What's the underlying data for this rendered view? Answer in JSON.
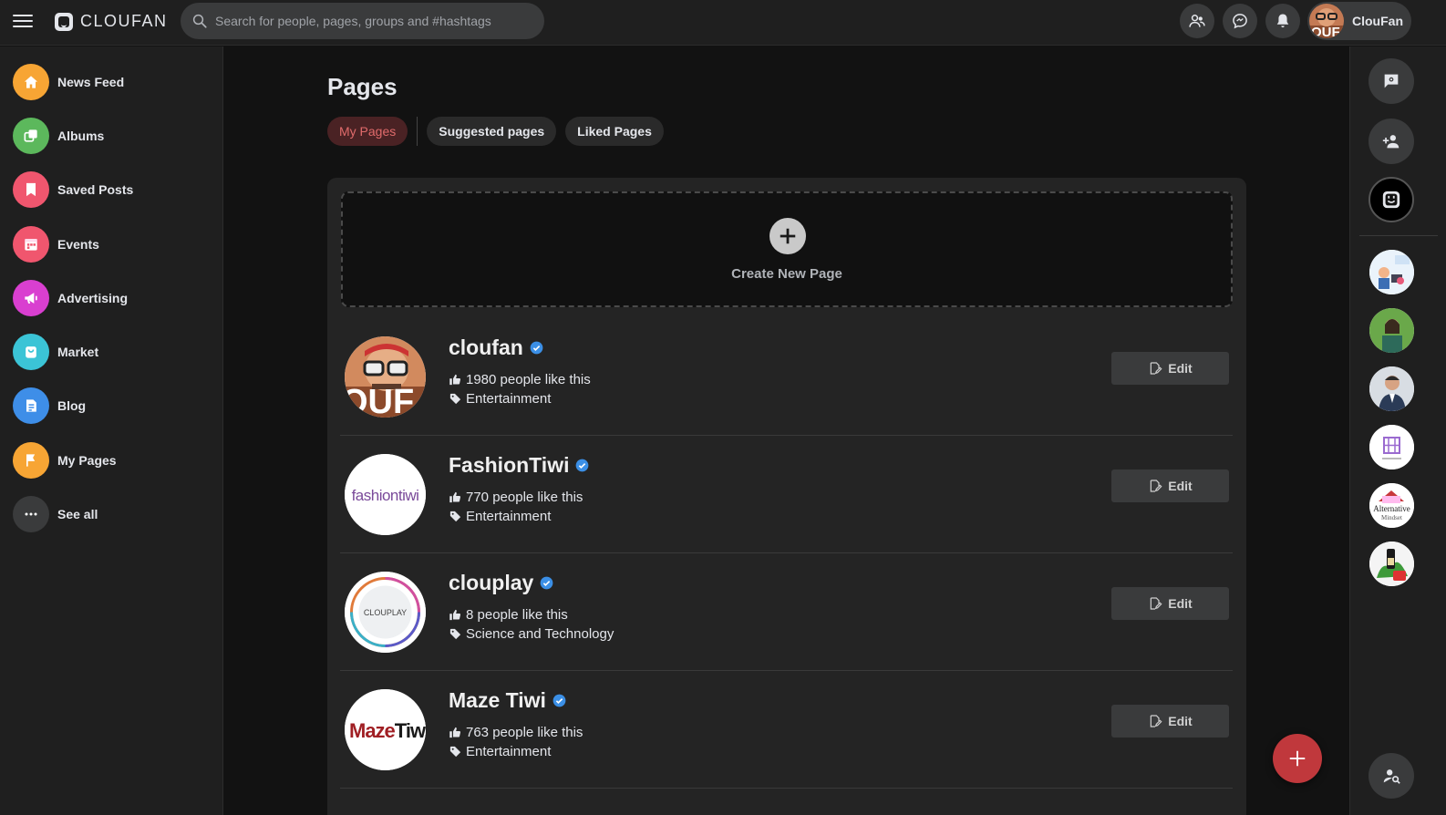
{
  "app": {
    "logo_text": "CLOUFAN"
  },
  "search": {
    "placeholder": "Search for people, pages, groups and #hashtags"
  },
  "header": {
    "user_name": "ClouFan"
  },
  "sidebar": {
    "items": [
      {
        "label": "News Feed",
        "icon": "home-icon",
        "color": "#f7a534"
      },
      {
        "label": "Albums",
        "icon": "albums-icon",
        "color": "#5cb85c"
      },
      {
        "label": "Saved Posts",
        "icon": "bookmark-icon",
        "color": "#f0566e"
      },
      {
        "label": "Events",
        "icon": "calendar-icon",
        "color": "#f0566e"
      },
      {
        "label": "Advertising",
        "icon": "megaphone-icon",
        "color": "#d93fd0"
      },
      {
        "label": "Market",
        "icon": "shopping-bag-icon",
        "color": "#3bc4d6"
      },
      {
        "label": "Blog",
        "icon": "blog-icon",
        "color": "#3e8ee8"
      },
      {
        "label": "My Pages",
        "icon": "flag-icon",
        "color": "#f7a534"
      },
      {
        "label": "See all",
        "icon": "more-icon",
        "color": "#3a3b3c"
      }
    ]
  },
  "main": {
    "title": "Pages",
    "tabs": [
      {
        "label": "My Pages",
        "active": true
      },
      {
        "label": "Suggested pages",
        "active": false
      },
      {
        "label": "Liked Pages",
        "active": false
      }
    ],
    "create_label": "Create New Page",
    "pages": [
      {
        "name": "cloufan",
        "likes": "1980 people like this",
        "category": "Entertainment",
        "edit_label": "Edit"
      },
      {
        "name": "FashionTiwi",
        "likes": "770 people like this",
        "category": "Entertainment",
        "edit_label": "Edit",
        "logo_text": "fashiontiwi"
      },
      {
        "name": "clouplay",
        "likes": "8 people like this",
        "category": "Science and Technology",
        "edit_label": "Edit",
        "logo_text": "CLOUPLAY"
      },
      {
        "name": "Maze Tiwi",
        "likes": "763 people like this",
        "category": "Entertainment",
        "edit_label": "Edit",
        "logo_text_a": "Maze",
        "logo_text_b": "Tiwi"
      }
    ]
  },
  "rightbar": {
    "avatar_texts": [
      "Alternative",
      "Mindset"
    ]
  },
  "colors": {
    "accent": "#c0383c",
    "verified": "#3b8fe6",
    "active_tab_text": "#e06b6b"
  }
}
